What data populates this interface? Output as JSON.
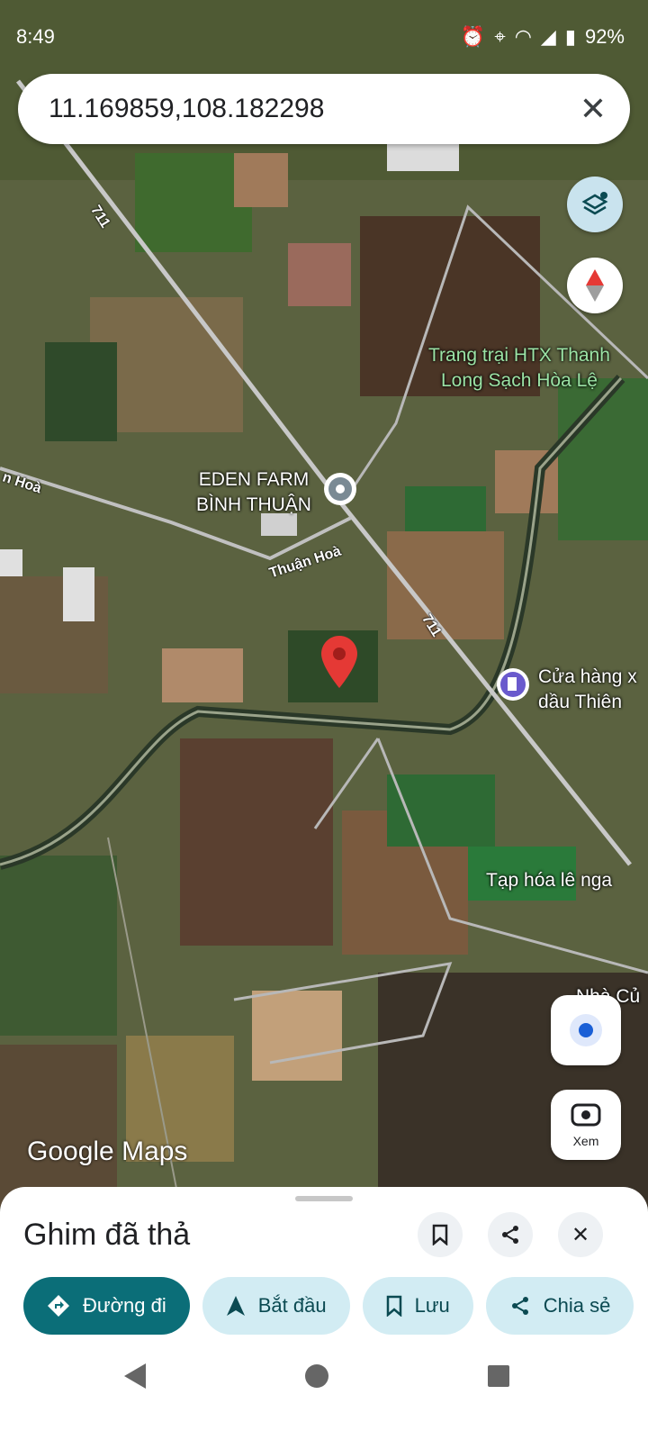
{
  "status_bar": {
    "time": "8:49",
    "battery": "92%"
  },
  "search": {
    "query": "11.169859,108.182298"
  },
  "map": {
    "labels": {
      "htx_line1": "Trang trại HTX Thanh",
      "htx_line2": "Long Sạch Hòa Lệ",
      "eden_line1": "EDEN FARM",
      "eden_line2": "BÌNH THUẬN",
      "thuan_hoa": "Thuận Hoà",
      "thuan_hoa_left": "n Hoà",
      "road_711_a": "711",
      "road_711_b": "711",
      "gas_line1": "Cửa hàng x",
      "gas_line2": "dầu Thiên",
      "tap_hoa": "Tạp hóa lê nga",
      "nha_cu": "Nhà Củ"
    },
    "attribution": "Google Maps",
    "xem_label": "Xem"
  },
  "sheet": {
    "title": "Ghim đã thả",
    "chips": {
      "directions": "Đường đi",
      "start": "Bắt đầu",
      "save": "Lưu",
      "share": "Chia sẻ"
    }
  },
  "colors": {
    "accent": "#0b6e78",
    "chip_bg": "#d2ecf3",
    "pin": "#e53935"
  }
}
